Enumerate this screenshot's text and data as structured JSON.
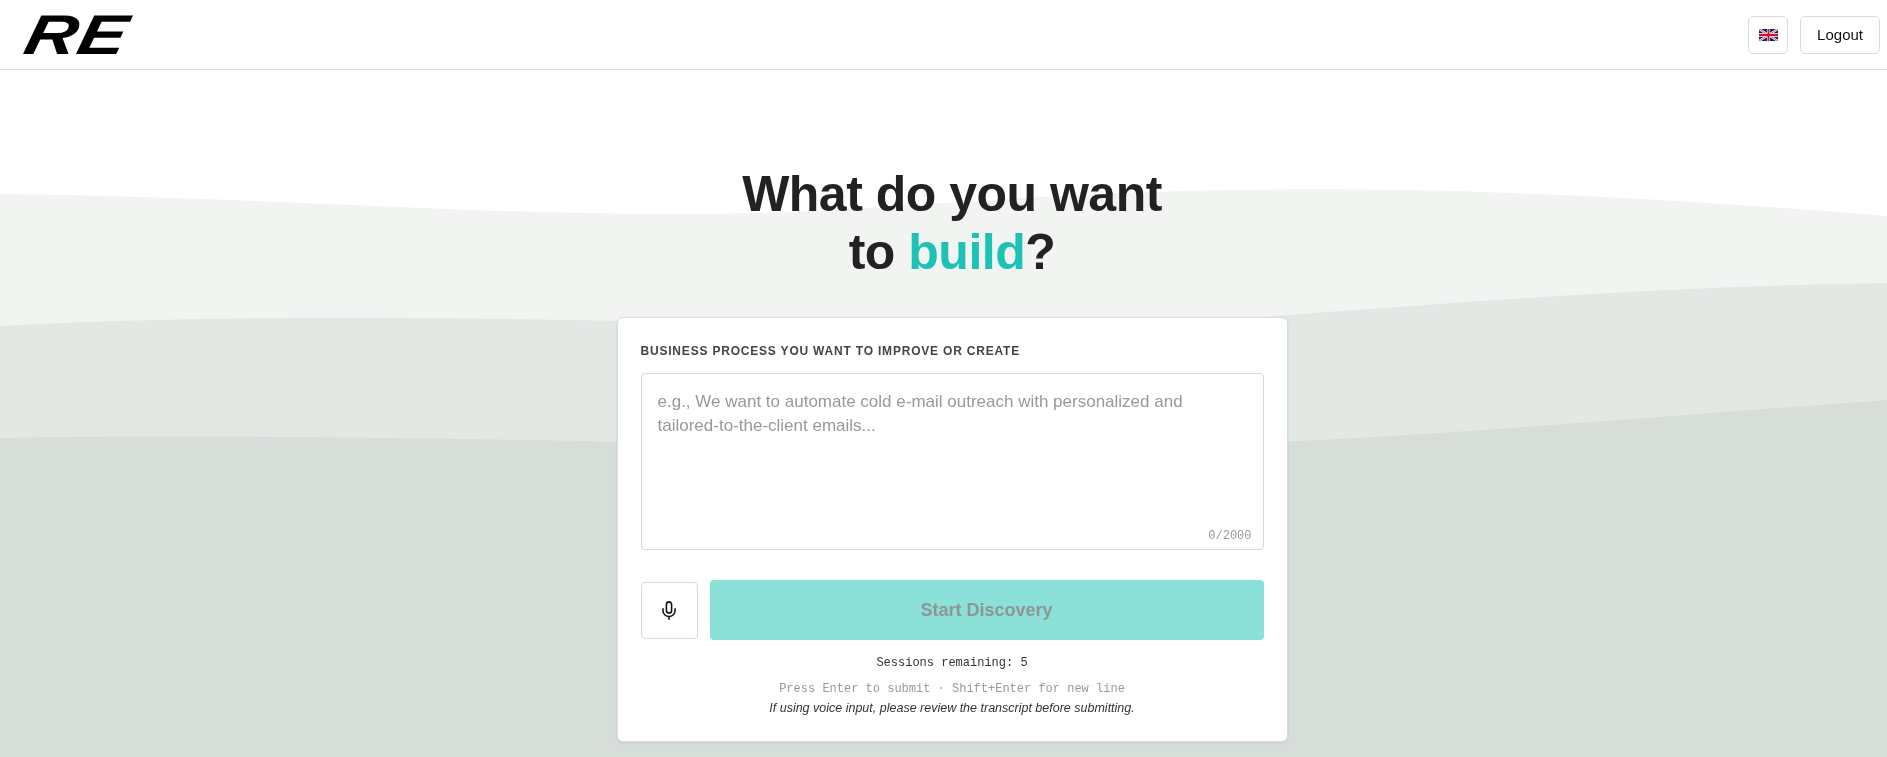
{
  "header": {
    "logo": "RE",
    "logout_button": "Logout"
  },
  "heading": {
    "parts": [
      {
        "text": "What do you want to ",
        "highlight": false
      },
      {
        "text": "build",
        "highlight": true
      },
      {
        "text": "?",
        "highlight": false
      }
    ]
  },
  "form": {
    "label": "BUSINESS PROCESS YOU WANT TO IMPROVE OR CREATE",
    "description": {
      "placeholder": "e.g., We want to automate cold e-mail outreach with personalized and tailored-to-the-client emails...",
      "counter": "0/2000"
    },
    "submit_button": {
      "label": "Start Discovery",
      "disabled": true
    },
    "sessions_remaining": "Sessions remaining: 5",
    "shortcut_hint": "Press Enter to submit · Shift+Enter for new line",
    "voice_note": "If using voice input, please review the transcript before submitting."
  }
}
